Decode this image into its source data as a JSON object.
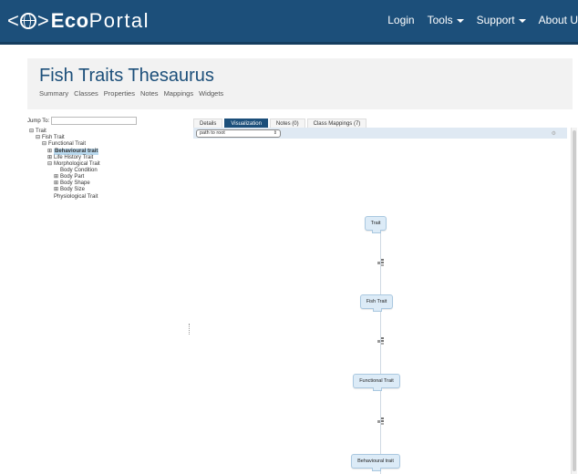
{
  "navbar": {
    "brand": {
      "prefix": "<",
      "suffix": ">",
      "eco": "Eco",
      "portal": "Portal"
    },
    "links": [
      "Login",
      "Tools",
      "Support",
      "About U"
    ],
    "colors": {
      "background": "#1c4f7a",
      "text": "#ffffff"
    }
  },
  "header": {
    "title": "Fish Traits Thesaurus",
    "tabs": [
      "Summary",
      "Classes",
      "Properties",
      "Notes",
      "Mappings",
      "Widgets"
    ]
  },
  "tree": {
    "jump_label": "Jump To:",
    "jump_value": "",
    "nodes": [
      {
        "label": "Trait",
        "toggle": "minus"
      },
      {
        "label": "Fish Trait",
        "toggle": "minus"
      },
      {
        "label": "Functional Trait",
        "toggle": "minus"
      },
      {
        "label": "Behavioural trait",
        "toggle": "plus",
        "selected": true
      },
      {
        "label": "Life History Trait",
        "toggle": "plus"
      },
      {
        "label": "Morphological Trait",
        "toggle": "minus"
      },
      {
        "label": "Body Condition",
        "toggle": "none"
      },
      {
        "label": "Body Part",
        "toggle": "plus"
      },
      {
        "label": "Body Shape",
        "toggle": "plus"
      },
      {
        "label": "Body Size",
        "toggle": "plus"
      },
      {
        "label": "Physiological Trait",
        "toggle": "none"
      }
    ]
  },
  "panel": {
    "tabs": [
      "Details",
      "Visualization",
      "Notes (0)",
      "Class Mappings (7)"
    ],
    "active_tab": "Visualization",
    "view_select": {
      "value": "path to root",
      "arrow": "⇕"
    },
    "graph_nodes": [
      "Trait",
      "Fish Trait",
      "Functional Trait",
      "Behavioural trait"
    ]
  }
}
